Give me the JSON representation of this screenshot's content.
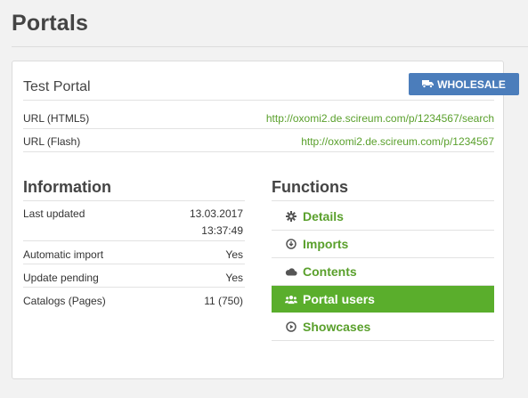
{
  "page": {
    "title": "Portals"
  },
  "portal": {
    "name": "Test Portal",
    "badge": {
      "label": "WHOLESALE",
      "icon": "truck-icon",
      "color": "#4b7dbb"
    },
    "urls": [
      {
        "label": "URL (HTML5)",
        "value": "http://oxomi2.de.scireum.com/p/1234567/search"
      },
      {
        "label": "URL (Flash)",
        "value": "http://oxomi2.de.scireum.com/p/1234567"
      }
    ]
  },
  "information": {
    "heading": "Information",
    "rows": [
      {
        "label": "Last updated",
        "value": "13.03.2017",
        "value2": "13:37:49"
      },
      {
        "label": "Automatic import",
        "value": "Yes"
      },
      {
        "label": "Update pending",
        "value": "Yes"
      },
      {
        "label": "Catalogs (Pages)",
        "value": "11 (750)"
      }
    ]
  },
  "functions": {
    "heading": "Functions",
    "items": [
      {
        "label": "Details",
        "icon": "gear-icon",
        "active": false
      },
      {
        "label": "Imports",
        "icon": "download-icon",
        "active": false
      },
      {
        "label": "Contents",
        "icon": "cloud-icon",
        "active": false
      },
      {
        "label": "Portal users",
        "icon": "users-icon",
        "active": true
      },
      {
        "label": "Showcases",
        "icon": "play-icon",
        "active": false
      }
    ]
  },
  "colors": {
    "link": "#5aa02c",
    "active_bg": "#5aae2c",
    "badge_bg": "#4b7dbb"
  }
}
